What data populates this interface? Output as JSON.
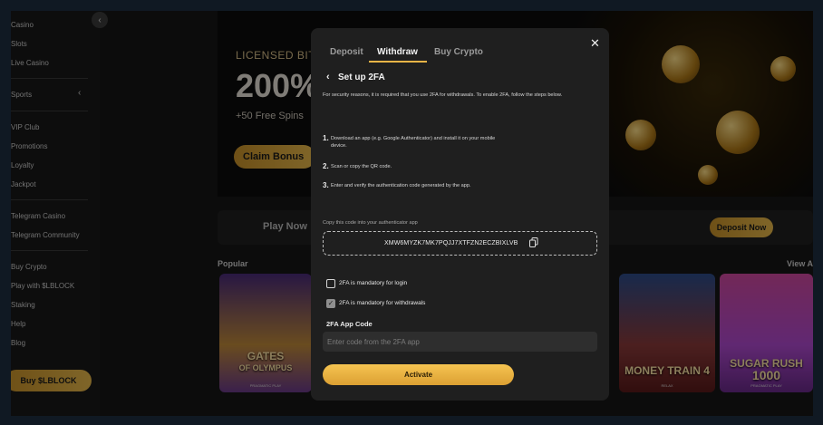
{
  "sidebar": {
    "items": [
      {
        "label": "Casino"
      },
      {
        "label": "Slots"
      },
      {
        "label": "Live Casino"
      },
      {
        "label": "Sports"
      },
      {
        "label": "VIP Club"
      },
      {
        "label": "Promotions"
      },
      {
        "label": "Loyalty"
      },
      {
        "label": "Jackpot"
      },
      {
        "label": "Telegram Casino"
      },
      {
        "label": "Telegram Community"
      },
      {
        "label": "Buy Crypto"
      },
      {
        "label": "Play with $LBLOCK"
      },
      {
        "label": "Staking"
      },
      {
        "label": "Help"
      },
      {
        "label": "Blog"
      }
    ],
    "buy_button": "Buy $LBLOCK",
    "collapse_icon": "chevron-left-icon",
    "sports_icon": "chevron-left-icon"
  },
  "banner": {
    "title": "LICENSED BITC",
    "headline": "200%",
    "spins": "+50 Free Spins",
    "claim": "Claim Bonus"
  },
  "play_bar": {
    "play_now": "Play Now",
    "deposit_now": "Deposit Now"
  },
  "section": {
    "popular": "Popular",
    "view_all": "View A"
  },
  "games": [
    {
      "title_line1": "GATES",
      "title_line2": "OF OLYMPUS",
      "provider": "PRAGMATIC PLAY"
    },
    {
      "title_line1": "MONEY TRAIN 4",
      "title_line2": "",
      "provider": "RELAX"
    },
    {
      "title_line1": "SUGAR RUSH",
      "title_line2": "1000",
      "provider": "PRAGMATIC PLAY"
    }
  ],
  "modal": {
    "tabs": [
      "Deposit",
      "Withdraw",
      "Buy Crypto"
    ],
    "active_tab": "Withdraw",
    "close_icon": "close-icon",
    "back_icon": "chevron-left-icon",
    "title": "Set up 2FA",
    "intro": "For security reasons, it is required that you use 2FA for withdrawals. To enable 2FA, follow the steps below.",
    "steps": [
      {
        "num": "1.",
        "text": "Download an app (e.g. Google Authenticator) and install it on your mobile device."
      },
      {
        "num": "2.",
        "text": "Scan or copy the QR code."
      },
      {
        "num": "3.",
        "text": "Enter and verify the authentication code generated by the app."
      }
    ],
    "copy_label": "Copy this code into your authenticator app",
    "code": "XMW6MYZK7MK7PQJJ7XTFZN2ECZBIXLVB",
    "copy_icon": "copy-icon",
    "checkboxes": [
      {
        "label": "2FA is mandatory for login",
        "checked": false
      },
      {
        "label": "2FA is mandatory for withdrawals",
        "checked": true
      }
    ],
    "app_code_label": "2FA App Code",
    "app_code_placeholder": "Enter code from the 2FA app",
    "activate": "Activate"
  },
  "colors": {
    "accent_gold": "#e7b446",
    "background": "#161616",
    "modal_bg": "#1f1f1f"
  }
}
